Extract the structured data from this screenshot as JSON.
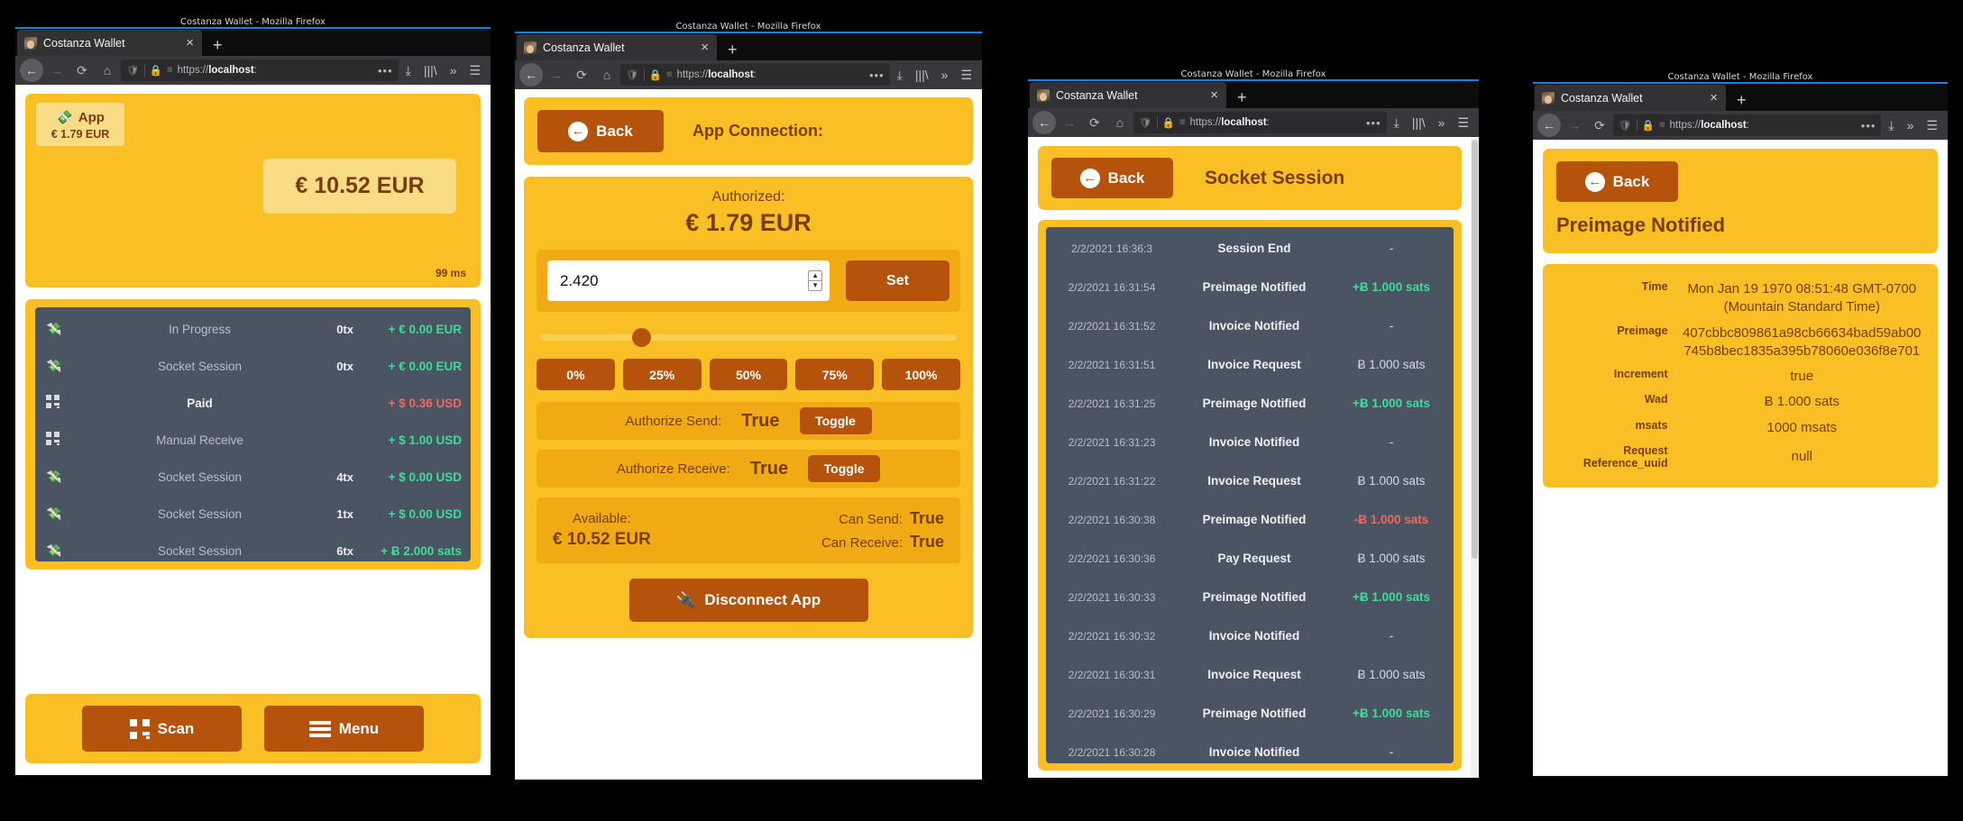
{
  "browser": {
    "window_title": "Costanza Wallet - Mozilla Firefox",
    "tab_title": "Costanza Wallet",
    "tab_close": "×",
    "new_tab": "+",
    "url_prefix": "https://",
    "url_host": "localhost",
    "url_suffix": ":",
    "url_dots": "•••",
    "icons": {
      "back": "←",
      "forward": "→",
      "reload": "⟳",
      "home": "⌂",
      "shield": "shield-icon",
      "lock": "lock-warning-icon",
      "perms": "permissions-icon",
      "download": "⤓",
      "library": "|||\\",
      "overflow": "»",
      "menu": "☰"
    }
  },
  "window1": {
    "app_chip": {
      "icon": "money-wings-icon",
      "label": "App",
      "amount": "€ 1.79 EUR"
    },
    "balance": "€ 10.52 EUR",
    "latency": "99 ms",
    "transactions": [
      {
        "icon": "money-wings-icon",
        "label": "In Progress",
        "tx": "0tx",
        "amount": "+ € 0.00 EUR",
        "tone": "green"
      },
      {
        "icon": "money-wings-icon",
        "label": "Socket Session",
        "tx": "0tx",
        "amount": "+ € 0.00 EUR",
        "tone": "green"
      },
      {
        "icon": "qr-icon",
        "label": "Paid",
        "tx": "",
        "amount": "+ $ 0.36 USD",
        "tone": "red"
      },
      {
        "icon": "qr-icon",
        "label": "Manual Receive",
        "tx": "",
        "amount": "+ $ 1.00 USD",
        "tone": "green"
      },
      {
        "icon": "money-wings-icon",
        "label": "Socket Session",
        "tx": "4tx",
        "amount": "+ $ 0.00 USD",
        "tone": "green"
      },
      {
        "icon": "money-wings-icon",
        "label": "Socket Session",
        "tx": "1tx",
        "amount": "+ $ 0.00 USD",
        "tone": "green"
      },
      {
        "icon": "money-wings-icon",
        "label": "Socket Session",
        "tx": "6tx",
        "amount": "+ Ƀ 2.000 sats",
        "tone": "green"
      }
    ],
    "footer": {
      "scan_label": "Scan",
      "scan_icon": "qr-icon",
      "menu_label": "Menu",
      "menu_icon": "hamburger-icon"
    }
  },
  "window2": {
    "back_label": "Back",
    "header_title": "App Connection:",
    "authorized_label": "Authorized:",
    "authorized_amount": "€ 1.79 EUR",
    "amount_input_value": "2.420",
    "set_label": "Set",
    "slider_percent": 25,
    "percent_buttons": [
      "0%",
      "25%",
      "50%",
      "75%",
      "100%"
    ],
    "authorize_send": {
      "label": "Authorize Send:",
      "value": "True",
      "toggle": "Toggle"
    },
    "authorize_receive": {
      "label": "Authorize Receive:",
      "value": "True",
      "toggle": "Toggle"
    },
    "available_label": "Available:",
    "available_amount": "€ 10.52 EUR",
    "can_send": {
      "label": "Can Send:",
      "value": "True"
    },
    "can_receive": {
      "label": "Can Receive:",
      "value": "True"
    },
    "disconnect_label": "Disconnect App",
    "disconnect_icon": "plug-icon"
  },
  "window3": {
    "back_label": "Back",
    "header_title": "Socket Session",
    "events": [
      {
        "time": "2/2/2021 16:36:3",
        "type": "Session End",
        "amount": "-",
        "tone": "grey"
      },
      {
        "time": "2/2/2021 16:31:54",
        "type": "Preimage Notified",
        "amount": "+Ƀ 1.000 sats",
        "tone": "green"
      },
      {
        "time": "2/2/2021 16:31:52",
        "type": "Invoice Notified",
        "amount": "-",
        "tone": "grey"
      },
      {
        "time": "2/2/2021 16:31:51",
        "type": "Invoice Request",
        "amount": "Ƀ 1.000 sats",
        "tone": "grey"
      },
      {
        "time": "2/2/2021 16:31:25",
        "type": "Preimage Notified",
        "amount": "+Ƀ 1.000 sats",
        "tone": "green"
      },
      {
        "time": "2/2/2021 16:31:23",
        "type": "Invoice Notified",
        "amount": "-",
        "tone": "grey"
      },
      {
        "time": "2/2/2021 16:31:22",
        "type": "Invoice Request",
        "amount": "Ƀ 1.000 sats",
        "tone": "grey"
      },
      {
        "time": "2/2/2021 16:30:38",
        "type": "Preimage Notified",
        "amount": "-Ƀ 1.000 sats",
        "tone": "red"
      },
      {
        "time": "2/2/2021 16:30:36",
        "type": "Pay Request",
        "amount": "Ƀ 1.000 sats",
        "tone": "grey"
      },
      {
        "time": "2/2/2021 16:30:33",
        "type": "Preimage Notified",
        "amount": "+Ƀ 1.000 sats",
        "tone": "green"
      },
      {
        "time": "2/2/2021 16:30:32",
        "type": "Invoice Notified",
        "amount": "-",
        "tone": "grey"
      },
      {
        "time": "2/2/2021 16:30:31",
        "type": "Invoice Request",
        "amount": "Ƀ 1.000 sats",
        "tone": "grey"
      },
      {
        "time": "2/2/2021 16:30:29",
        "type": "Preimage Notified",
        "amount": "+Ƀ 1.000 sats",
        "tone": "green"
      },
      {
        "time": "2/2/2021 16:30:28",
        "type": "Invoice Notified",
        "amount": "-",
        "tone": "grey"
      }
    ]
  },
  "window4": {
    "back_label": "Back",
    "header_title": "Preimage Notified",
    "details": [
      {
        "key": "Time",
        "value": "Mon Jan 19 1970 08:51:48 GMT-0700 (Mountain Standard Time)"
      },
      {
        "key": "Preimage",
        "value": "407cbbc809861a98cb66634bad59ab00745b8bec1835a395b78060e036f8e701"
      },
      {
        "key": "Increment",
        "value": "true"
      },
      {
        "key": "Wad",
        "value": "Ƀ 1.000 sats"
      },
      {
        "key": "msats",
        "value": "1000 msats"
      },
      {
        "key": "Request Reference_uuid",
        "value": "null"
      }
    ]
  },
  "colors": {
    "brand_yellow": "#f9bf24",
    "brand_brown": "#b5530c",
    "text_brown": "#7a3d08",
    "list_dark": "#4b5463",
    "green": "#3ddc97",
    "red": "#f0685f"
  }
}
